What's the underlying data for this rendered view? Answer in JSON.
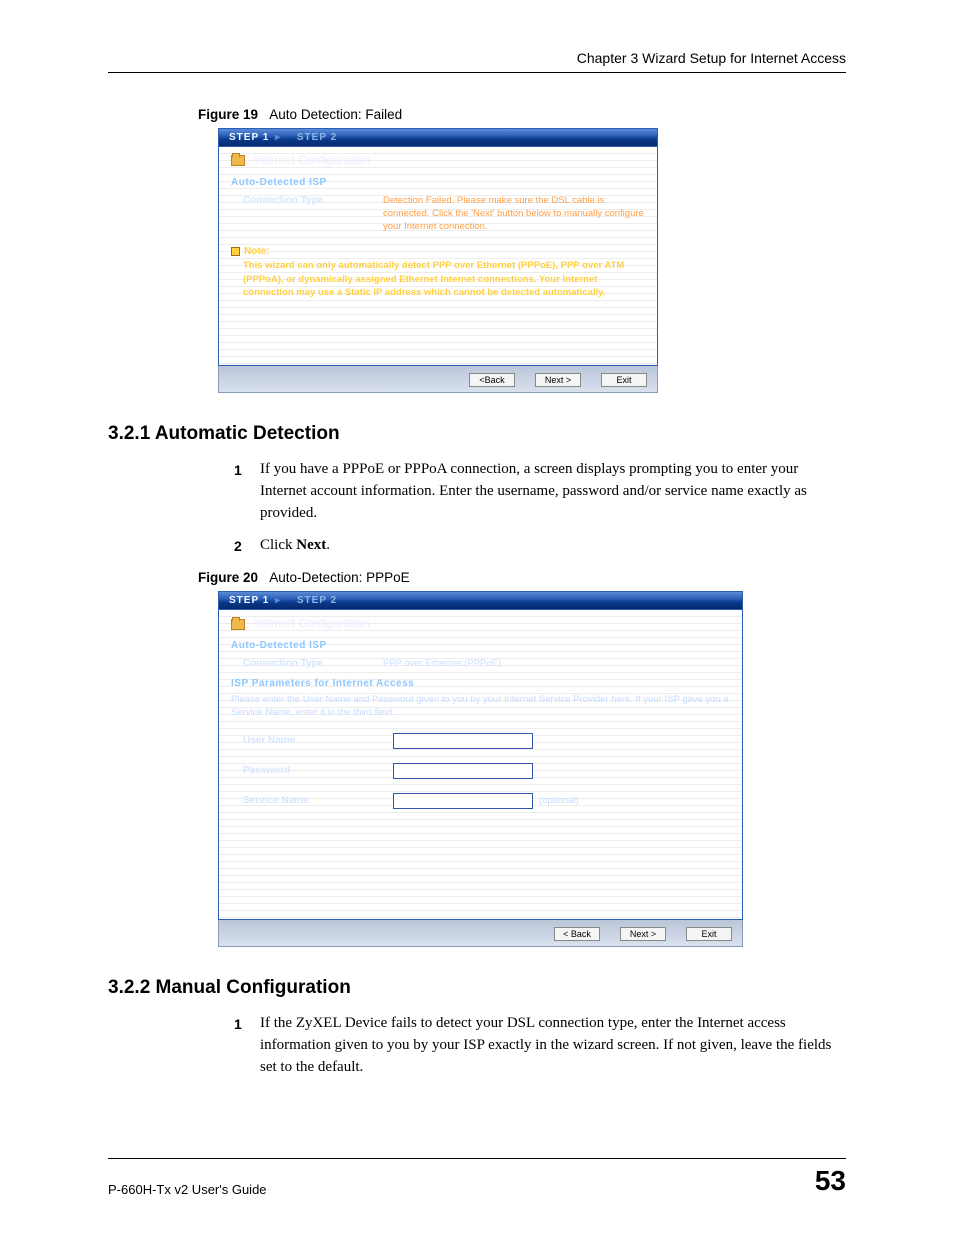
{
  "header": {
    "chapter": "Chapter 3 Wizard Setup for Internet Access"
  },
  "fig19": {
    "label": "Figure 19",
    "title": "Auto Detection: Failed",
    "steps": {
      "step1": "STEP 1",
      "step2": "STEP 2"
    },
    "window_title": "Internet Configuration",
    "section1": "Auto-Detected ISP",
    "conn_type_label": "Connection Type",
    "conn_type_value": "Detection Failed. Please make sure the DSL cable is connected. Click the 'Next' button below to manually configure your Internet connection.",
    "note_label": "Note:",
    "note_text": "This wizard can only automatically detect PPP over Ethernet (PPPoE), PPP over ATM (PPPoA), or dynamically assigned Ethernet Internet connections. Your Internet connection may use a Static IP address which cannot be detected automatically.",
    "buttons": {
      "back": "<Back",
      "next": "Next >",
      "exit": "Exit"
    }
  },
  "sec321": {
    "heading": "3.2.1  Automatic Detection",
    "items": [
      "If you have a PPPoE or PPPoA connection, a screen displays prompting you to enter your Internet account information. Enter the username, password and/or service name exactly as provided.",
      "Click Next."
    ],
    "next_bold": "Next"
  },
  "fig20": {
    "label": "Figure 20",
    "title": "Auto-Detection: PPPoE",
    "steps": {
      "step1": "STEP 1",
      "step2": "STEP 2"
    },
    "window_title": "Internet Configuration",
    "section1": "Auto-Detected ISP",
    "conn_type_label": "Connection Type",
    "conn_type_value": "PPP over Ethernet (PPPoE)",
    "section2": "ISP Parameters for Internet Access",
    "section2_desc": "Please enter the User Name and Password given to you by your Internet Service Provider here. If your ISP gave you a Service Name, enter it in the third field.",
    "username_label": "User Name",
    "password_label": "Password",
    "service_label": "Service Name",
    "optional": "(optional)",
    "buttons": {
      "back": "< Back",
      "next": "Next >",
      "exit": "Exit"
    }
  },
  "sec322": {
    "heading": "3.2.2  Manual Configuration",
    "items": [
      "If the ZyXEL Device fails to detect your DSL connection type, enter the Internet access information given to you by your ISP exactly in the wizard screen. If not given, leave the fields set to the default."
    ]
  },
  "footer": {
    "guide": "P-660H-Tx v2 User's Guide",
    "page": "53"
  }
}
